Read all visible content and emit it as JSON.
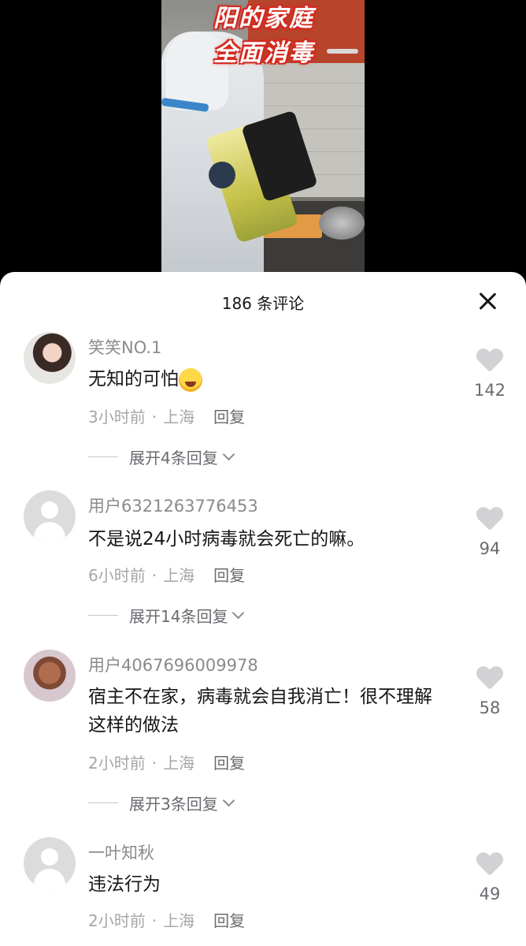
{
  "video": {
    "caption_line1": "阳的家庭",
    "caption_line2": "全面消毒"
  },
  "sheet": {
    "title": "186 条评论"
  },
  "comments": [
    {
      "username": "笑笑NO.1",
      "text": "无知的可怕",
      "emoji": "face-with-tears-of-joy",
      "time": "3小时前",
      "location": "上海",
      "reply": "回复",
      "expand": "展开4条回复",
      "likes": "142"
    },
    {
      "username": "用户6321263776453",
      "text": "不是说24小时病毒就会死亡的嘛。",
      "time": "6小时前",
      "location": "上海",
      "reply": "回复",
      "expand": "展开14条回复",
      "likes": "94"
    },
    {
      "username": "用户4067696009978",
      "text": "宿主不在家，病毒就会自我消亡！很不理解这样的做法",
      "time": "2小时前",
      "location": "上海",
      "reply": "回复",
      "expand": "展开3条回复",
      "likes": "58"
    },
    {
      "username": "一叶知秋",
      "text": "违法行为",
      "time": "2小时前",
      "location": "上海",
      "reply": "回复",
      "likes": "49"
    }
  ],
  "separator": "·"
}
